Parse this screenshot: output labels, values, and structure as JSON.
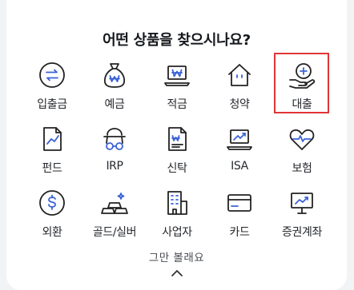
{
  "title": "어떤 상품을 찾으시나요?",
  "products": [
    {
      "label": "입출금",
      "icon": "transfer-arrows-icon"
    },
    {
      "label": "예금",
      "icon": "money-bag-icon"
    },
    {
      "label": "적금",
      "icon": "laptop-won-icon"
    },
    {
      "label": "청약",
      "icon": "house-icon"
    },
    {
      "label": "대출",
      "icon": "hand-coin-icon"
    },
    {
      "label": "펀드",
      "icon": "document-chart-icon"
    },
    {
      "label": "IRP",
      "icon": "person-glasses-icon"
    },
    {
      "label": "신탁",
      "icon": "document-won-icon"
    },
    {
      "label": "ISA",
      "icon": "laptop-chart-icon"
    },
    {
      "label": "보험",
      "icon": "heart-pulse-icon"
    },
    {
      "label": "외환",
      "icon": "dollar-coin-icon"
    },
    {
      "label": "골드/실버",
      "icon": "gold-bars-icon"
    },
    {
      "label": "사업자",
      "icon": "building-icon"
    },
    {
      "label": "카드",
      "icon": "credit-card-icon"
    },
    {
      "label": "증권계좌",
      "icon": "monitor-chart-icon"
    }
  ],
  "highlighted_item": "대출",
  "accent_color": "#3b63d6",
  "highlight_color": "#e03636",
  "footer": {
    "dismiss_label": "그만 볼래요",
    "collapse_icon": "chevron-up-icon"
  }
}
